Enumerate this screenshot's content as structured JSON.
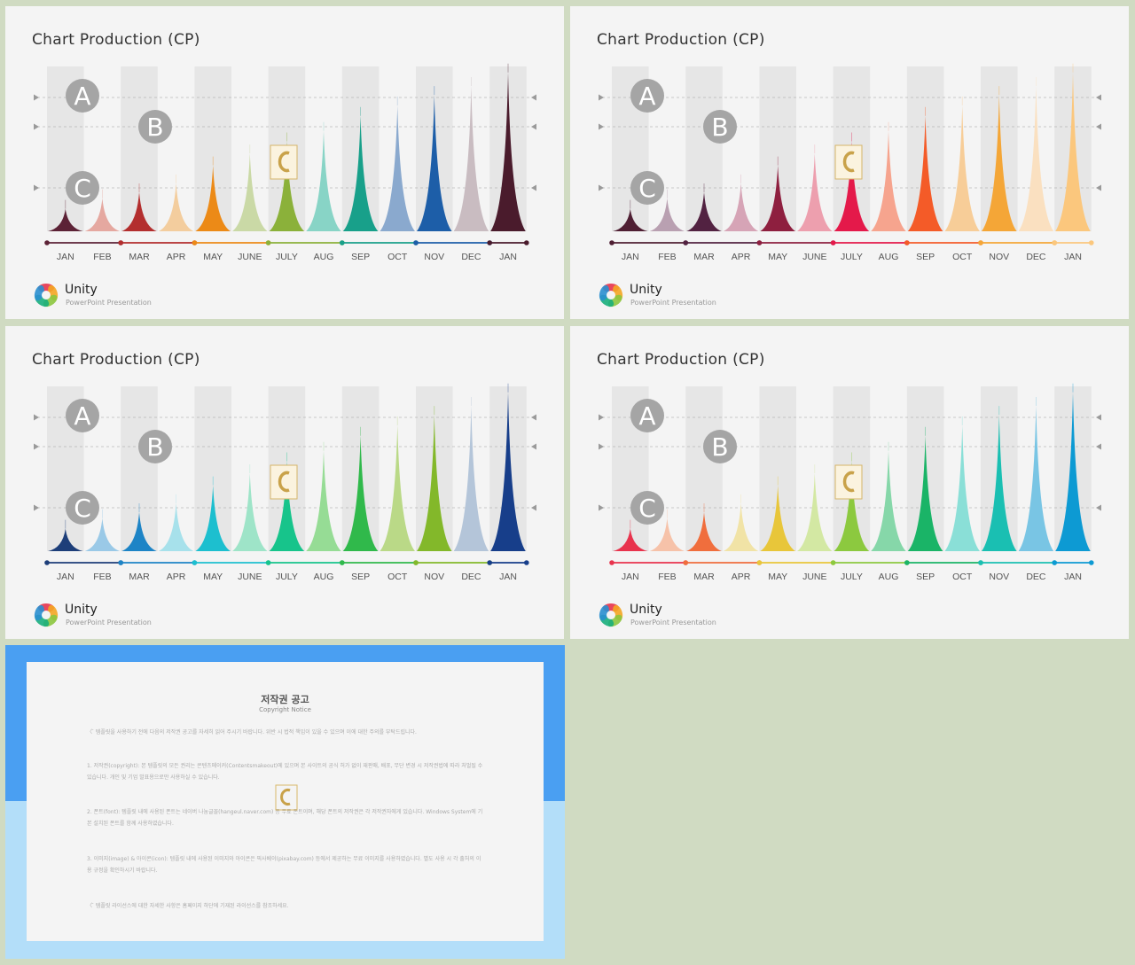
{
  "slides": [
    {
      "title": "Chart Production (CP)",
      "colors": [
        "#5c2236",
        "#e5a8a0",
        "#b32e2e",
        "#f3cd9e",
        "#ec8a17",
        "#cad9a6",
        "#8bb13a",
        "#88d4c6",
        "#18a08a",
        "#8aa9ce",
        "#1d5ea8",
        "#c9bcc1",
        "#4a1b2c"
      ]
    },
    {
      "title": "Chart Production (CP)",
      "colors": [
        "#4f1f33",
        "#b9a0b1",
        "#522241",
        "#d6a4b6",
        "#8e1f3f",
        "#ed9fae",
        "#e4194a",
        "#f6a48e",
        "#f45b28",
        "#f7cd98",
        "#f4a637",
        "#fae0c0",
        "#fbc77d"
      ]
    },
    {
      "title": "Chart Production (CP)",
      "colors": [
        "#1d3e79",
        "#9ac9e7",
        "#1d84c6",
        "#a7e1eb",
        "#1dbfcf",
        "#9ee4c8",
        "#17c48b",
        "#96dc95",
        "#30b94b",
        "#bad987",
        "#83b82a",
        "#b4c5d9",
        "#173e8a"
      ]
    },
    {
      "title": "Chart Production (CP)",
      "colors": [
        "#e8334d",
        "#f6c2a9",
        "#f06e3d",
        "#f1e3a6",
        "#e8c63a",
        "#d3e8a3",
        "#8cc93f",
        "#86d7a9",
        "#1ab467",
        "#8adfd7",
        "#1abfb2",
        "#79c5e4",
        "#0d9ad3"
      ]
    }
  ],
  "chart_data": {
    "type": "area",
    "categories": [
      "JAN",
      "FEB",
      "MAR",
      "APR",
      "MAY",
      "JUNE",
      "JULY",
      "AUG",
      "SEP",
      "OCT",
      "NOV",
      "DEC",
      "JAN"
    ],
    "values": [
      15,
      22,
      26,
      32,
      44,
      52,
      60,
      67,
      77,
      84,
      91,
      97,
      106
    ],
    "ylim": [
      0,
      110
    ],
    "markers": [
      "A",
      "B",
      "C"
    ]
  },
  "brand": {
    "name": "Unity",
    "subtitle": "PowerPoint Presentation"
  },
  "notice": {
    "title": "저작권 공고",
    "subtitle": "Copyright Notice",
    "paragraphs": [
      "〈 ̄ 템플릿을 사용하기 전에 다음의 저작권 공고를 자세히 읽어 주시기 바랍니다. 위반 시 법적 책임이 있을 수 있으며 이에 대한 주의를 부탁드립니다.",
      "1. 저작권(copyright): 본 템플릿의 모든 권리는 콘텐츠메이커(Contentsmakeout)에 있으며 본 사이트의 공식 허가 없이 재판매, 배포, 무단 변경 시 저작권법에 따라 처벌될 수 있습니다. 개인 및 기업 발표용으로만 사용하실 수 있습니다.",
      "2. 폰트(font): 템플릿 내에 사용된 폰트는 네이버 나눔글꼴(hangeul.naver.com) 등 무료 폰트이며, 해당 폰트의 저작권은 각 저작권자에게 있습니다. Windows System에 기본 설치된 폰트를 함께 사용하였습니다.",
      "3. 이미지(image) & 아이콘(icon): 템플릿 내에 사용된 이미지와 아이콘은 픽사베이(pixabay.com) 등에서 제공하는 무료 이미지를 사용하였습니다. 별도 사용 시 각 출처의 이용 규정을 확인하시기 바랍니다.",
      "〈 ̄ 템플릿 라이선스에 대한 자세한 사항은 홈페이지 하단에 기재된 라이선스를 참조하세요."
    ]
  }
}
